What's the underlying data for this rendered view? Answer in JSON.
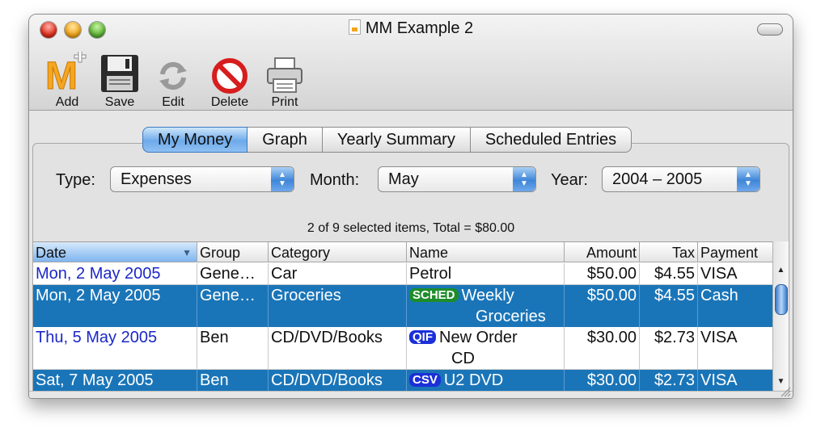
{
  "window": {
    "title": "MM Example 2"
  },
  "toolbar": {
    "add": "Add",
    "save": "Save",
    "edit": "Edit",
    "delete": "Delete",
    "print": "Print"
  },
  "tabs": [
    "My Money",
    "Graph",
    "Yearly Summary",
    "Scheduled Entries"
  ],
  "active_tab": "My Money",
  "filters": {
    "type_label": "Type:",
    "type_value": "Expenses",
    "month_label": "Month:",
    "month_value": "May",
    "year_label": "Year:",
    "year_value": "2004 – 2005"
  },
  "summary": "2 of 9 selected items, Total = $80.00",
  "table": {
    "columns": [
      "Date",
      "Group",
      "Category",
      "Name",
      "Amount",
      "Tax",
      "Payment"
    ],
    "sorted_column": "Date",
    "rows": [
      {
        "date": "Mon, 2 May 2005",
        "group": "Gene…",
        "category": "Car",
        "badge": "",
        "name": "Petrol",
        "name2": "",
        "amount": "$50.00",
        "tax": "$4.55",
        "payment": "VISA",
        "selected": false
      },
      {
        "date": "Mon, 2 May 2005",
        "group": "Gene…",
        "category": "Groceries",
        "badge": "SCHED",
        "name": "Weekly",
        "name2": "Groceries",
        "amount": "$50.00",
        "tax": "$4.55",
        "payment": "Cash",
        "selected": true
      },
      {
        "date": "Thu, 5 May 2005",
        "group": "Ben",
        "category": "CD/DVD/Books",
        "badge": "QIF",
        "name": "New Order",
        "name2": "CD",
        "amount": "$30.00",
        "tax": "$2.73",
        "payment": "VISA",
        "selected": false
      },
      {
        "date": "Sat, 7 May 2005",
        "group": "Ben",
        "category": "CD/DVD/Books",
        "badge": "CSV",
        "name": "U2 DVD",
        "name2": "",
        "amount": "$30.00",
        "tax": "$2.73",
        "payment": "VISA",
        "selected": true
      }
    ]
  },
  "colors": {
    "selection": "#1a75b8",
    "date_text": "#1b27c8",
    "sched_badge": "#1d8d2b",
    "import_badge": "#1b30d8",
    "add_icon": "#f5a623"
  }
}
